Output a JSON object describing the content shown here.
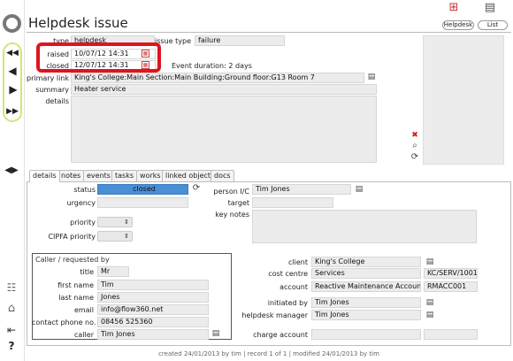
{
  "header": {
    "title": "Helpdesk issue",
    "buttons": [
      {
        "label": "Helpdesk"
      },
      {
        "label": "List"
      }
    ]
  },
  "record": {
    "type": {
      "label": "type",
      "value": "helpdesk"
    },
    "issue_type": {
      "label": "issue type",
      "value": "failure"
    },
    "raised": {
      "label": "raised",
      "value": "10/07/12 14:31"
    },
    "closed": {
      "label": "closed",
      "value": "12/07/12 14:31"
    },
    "event_duration": "Event duration: 2 days",
    "primary_link": {
      "label": "primary link",
      "value": "King's College:Main Section:Main Building:Ground floor:G13 Room 7"
    },
    "summary": {
      "label": "summary",
      "value": "Heater service"
    },
    "details": {
      "label": "details",
      "value": ""
    }
  },
  "tabs": [
    "details",
    "notes",
    "events",
    "tasks",
    "works",
    "linked objects",
    "docs"
  ],
  "details": {
    "status": {
      "label": "status",
      "value": "closed"
    },
    "urgency": {
      "label": "urgency"
    },
    "priority": {
      "label": "priority"
    },
    "cipfa": {
      "label": "CIPFA priority"
    },
    "person": {
      "label": "person I/C",
      "value": "Tim Jones"
    },
    "target": {
      "label": "target"
    },
    "key_notes": {
      "label": "key notes"
    },
    "caller_box": {
      "legend": "Caller / requested by",
      "title": {
        "label": "title",
        "value": "Mr"
      },
      "first_name": {
        "label": "first name",
        "value": "Tim"
      },
      "last_name": {
        "label": "last name",
        "value": "Jones"
      },
      "email": {
        "label": "email",
        "value": "info@flow360.net"
      },
      "phone": {
        "label": "contact phone no.",
        "value": "08456 525360"
      },
      "caller": {
        "label": "caller",
        "value": "Tim Jones"
      }
    },
    "client": {
      "label": "client",
      "value": "King's College"
    },
    "cost_centre": {
      "label": "cost centre",
      "value": "Services",
      "code": "KC/SERV/1001"
    },
    "account": {
      "label": "account",
      "value": "Reactive Maintenance Account",
      "code": "RMACC001"
    },
    "initiated_by": {
      "label": "initiated by",
      "value": "Tim Jones"
    },
    "helpdesk_manager": {
      "label": "helpdesk manager",
      "value": "Tim Jones"
    },
    "charge_account": {
      "label": "charge account"
    }
  },
  "footer": "created 24/01/2013 by tim | record 1 of 1 | modified 24/01/2013 by tim",
  "colors": {
    "status_fill": "#4a8fd6",
    "highlight": "#e0141c",
    "nav_pill": "#d8e27a"
  }
}
